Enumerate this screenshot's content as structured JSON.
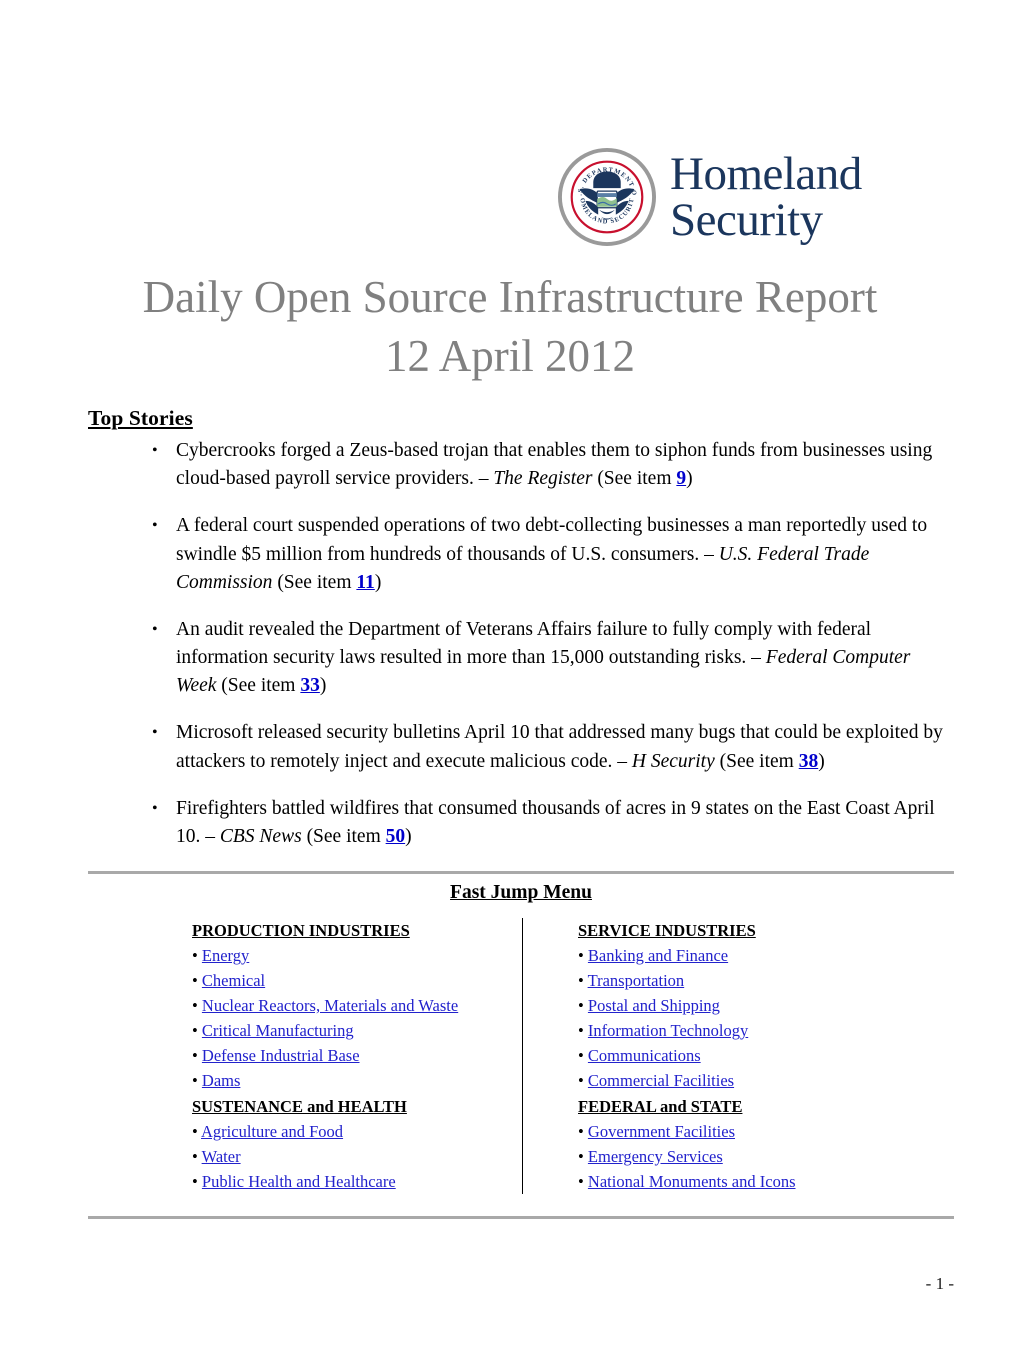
{
  "header": {
    "agency_line1": "Homeland",
    "agency_line2": "Security",
    "seal_text_top": "U.S. DEPARTMENT OF",
    "seal_text_bottom": "HOMELAND SECURITY",
    "navy": "#1b365d"
  },
  "title": {
    "line1": "Daily Open Source Infrastructure Report",
    "line2": "12 April 2012",
    "color": "#808080"
  },
  "top_stories": {
    "heading": "Top Stories",
    "items": [
      {
        "text_before": "Cybercrooks forged a Zeus-based trojan that enables them to siphon funds from businesses using cloud-based payroll service providers. – ",
        "source": "The Register",
        "see_prefix": " (See item ",
        "item_number": "9",
        "see_suffix": ")"
      },
      {
        "text_before": "A federal court suspended operations of two debt-collecting businesses a man reportedly used to swindle $5 million from hundreds of thousands of U.S. consumers. – ",
        "source": "U.S. Federal Trade Commission",
        "see_prefix": " (See item ",
        "item_number": "11",
        "see_suffix": ")"
      },
      {
        "text_before": "An audit revealed the Department of Veterans Affairs failure to fully comply with federal information security laws resulted in more than 15,000 outstanding risks. – ",
        "source": "Federal Computer Week",
        "see_prefix": " (See item ",
        "item_number": "33",
        "see_suffix": ")"
      },
      {
        "text_before": "Microsoft released security bulletins April 10 that addressed many bugs that could be exploited by attackers to remotely inject and execute malicious code. – ",
        "source": "H Security",
        "see_prefix": " (See ",
        "item_number": "38",
        "see_suffix": ")",
        "see_item_word": "item "
      },
      {
        "text_before": "Firefighters battled wildfires that consumed thousands of acres in 9 states on the East Coast April 10. – ",
        "source": "CBS News",
        "see_prefix": " (See item ",
        "item_number": "50",
        "see_suffix": ")"
      }
    ]
  },
  "fast_jump_menu": {
    "title": "Fast Jump Menu",
    "link_color": "#2222cc",
    "left_column": {
      "groups": [
        {
          "heading": "PRODUCTION INDUSTRIES",
          "links": [
            "Energy ",
            "Chemical ",
            "Nuclear Reactors, Materials and Waste ",
            "Critical Manufacturing ",
            "Defense Industrial Base ",
            "Dams "
          ]
        },
        {
          "heading": "SUSTENANCE and HEALTH ",
          "links": [
            "Agriculture and Food ",
            "Water ",
            "Public Health and Healthcare "
          ]
        }
      ]
    },
    "right_column": {
      "groups": [
        {
          "heading": "SERVICE INDUSTRIES",
          "links": [
            "Banking and Finance ",
            "Transportation ",
            "Postal and Shipping ",
            "Information Technology ",
            "Communications ",
            "Commercial Facilities "
          ]
        },
        {
          "heading": "FEDERAL and STATE",
          "links": [
            "Government Facilities ",
            "Emergency Services ",
            "National Monuments and Icons "
          ]
        }
      ]
    },
    "bullet_char": "•"
  },
  "footer": {
    "page_marker": "- 1 -"
  }
}
